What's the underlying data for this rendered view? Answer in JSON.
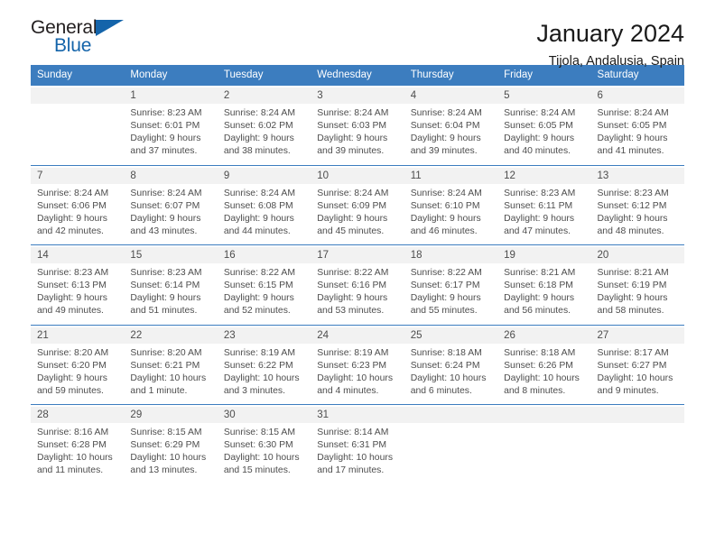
{
  "logo": {
    "word_one": "General",
    "word_two": "Blue",
    "triangle": "triangle-mark",
    "brand_color": "#1464aa",
    "text_color": "#231f20"
  },
  "header": {
    "title": "January 2024",
    "subtitle": "Tijola, Andalusia, Spain"
  },
  "calendar": {
    "header_bg": "#3c7dbf",
    "daynum_bg": "#f2f2f2",
    "weekdays": [
      "Sunday",
      "Monday",
      "Tuesday",
      "Wednesday",
      "Thursday",
      "Friday",
      "Saturday"
    ],
    "weeks": [
      {
        "days": [
          {
            "num": "",
            "sunrise": "",
            "sunset": "",
            "daylight": ""
          },
          {
            "num": "1",
            "sunrise": "Sunrise: 8:23 AM",
            "sunset": "Sunset: 6:01 PM",
            "daylight": "Daylight: 9 hours and 37 minutes."
          },
          {
            "num": "2",
            "sunrise": "Sunrise: 8:24 AM",
            "sunset": "Sunset: 6:02 PM",
            "daylight": "Daylight: 9 hours and 38 minutes."
          },
          {
            "num": "3",
            "sunrise": "Sunrise: 8:24 AM",
            "sunset": "Sunset: 6:03 PM",
            "daylight": "Daylight: 9 hours and 39 minutes."
          },
          {
            "num": "4",
            "sunrise": "Sunrise: 8:24 AM",
            "sunset": "Sunset: 6:04 PM",
            "daylight": "Daylight: 9 hours and 39 minutes."
          },
          {
            "num": "5",
            "sunrise": "Sunrise: 8:24 AM",
            "sunset": "Sunset: 6:05 PM",
            "daylight": "Daylight: 9 hours and 40 minutes."
          },
          {
            "num": "6",
            "sunrise": "Sunrise: 8:24 AM",
            "sunset": "Sunset: 6:05 PM",
            "daylight": "Daylight: 9 hours and 41 minutes."
          }
        ]
      },
      {
        "days": [
          {
            "num": "7",
            "sunrise": "Sunrise: 8:24 AM",
            "sunset": "Sunset: 6:06 PM",
            "daylight": "Daylight: 9 hours and 42 minutes."
          },
          {
            "num": "8",
            "sunrise": "Sunrise: 8:24 AM",
            "sunset": "Sunset: 6:07 PM",
            "daylight": "Daylight: 9 hours and 43 minutes."
          },
          {
            "num": "9",
            "sunrise": "Sunrise: 8:24 AM",
            "sunset": "Sunset: 6:08 PM",
            "daylight": "Daylight: 9 hours and 44 minutes."
          },
          {
            "num": "10",
            "sunrise": "Sunrise: 8:24 AM",
            "sunset": "Sunset: 6:09 PM",
            "daylight": "Daylight: 9 hours and 45 minutes."
          },
          {
            "num": "11",
            "sunrise": "Sunrise: 8:24 AM",
            "sunset": "Sunset: 6:10 PM",
            "daylight": "Daylight: 9 hours and 46 minutes."
          },
          {
            "num": "12",
            "sunrise": "Sunrise: 8:23 AM",
            "sunset": "Sunset: 6:11 PM",
            "daylight": "Daylight: 9 hours and 47 minutes."
          },
          {
            "num": "13",
            "sunrise": "Sunrise: 8:23 AM",
            "sunset": "Sunset: 6:12 PM",
            "daylight": "Daylight: 9 hours and 48 minutes."
          }
        ]
      },
      {
        "days": [
          {
            "num": "14",
            "sunrise": "Sunrise: 8:23 AM",
            "sunset": "Sunset: 6:13 PM",
            "daylight": "Daylight: 9 hours and 49 minutes."
          },
          {
            "num": "15",
            "sunrise": "Sunrise: 8:23 AM",
            "sunset": "Sunset: 6:14 PM",
            "daylight": "Daylight: 9 hours and 51 minutes."
          },
          {
            "num": "16",
            "sunrise": "Sunrise: 8:22 AM",
            "sunset": "Sunset: 6:15 PM",
            "daylight": "Daylight: 9 hours and 52 minutes."
          },
          {
            "num": "17",
            "sunrise": "Sunrise: 8:22 AM",
            "sunset": "Sunset: 6:16 PM",
            "daylight": "Daylight: 9 hours and 53 minutes."
          },
          {
            "num": "18",
            "sunrise": "Sunrise: 8:22 AM",
            "sunset": "Sunset: 6:17 PM",
            "daylight": "Daylight: 9 hours and 55 minutes."
          },
          {
            "num": "19",
            "sunrise": "Sunrise: 8:21 AM",
            "sunset": "Sunset: 6:18 PM",
            "daylight": "Daylight: 9 hours and 56 minutes."
          },
          {
            "num": "20",
            "sunrise": "Sunrise: 8:21 AM",
            "sunset": "Sunset: 6:19 PM",
            "daylight": "Daylight: 9 hours and 58 minutes."
          }
        ]
      },
      {
        "days": [
          {
            "num": "21",
            "sunrise": "Sunrise: 8:20 AM",
            "sunset": "Sunset: 6:20 PM",
            "daylight": "Daylight: 9 hours and 59 minutes."
          },
          {
            "num": "22",
            "sunrise": "Sunrise: 8:20 AM",
            "sunset": "Sunset: 6:21 PM",
            "daylight": "Daylight: 10 hours and 1 minute."
          },
          {
            "num": "23",
            "sunrise": "Sunrise: 8:19 AM",
            "sunset": "Sunset: 6:22 PM",
            "daylight": "Daylight: 10 hours and 3 minutes."
          },
          {
            "num": "24",
            "sunrise": "Sunrise: 8:19 AM",
            "sunset": "Sunset: 6:23 PM",
            "daylight": "Daylight: 10 hours and 4 minutes."
          },
          {
            "num": "25",
            "sunrise": "Sunrise: 8:18 AM",
            "sunset": "Sunset: 6:24 PM",
            "daylight": "Daylight: 10 hours and 6 minutes."
          },
          {
            "num": "26",
            "sunrise": "Sunrise: 8:18 AM",
            "sunset": "Sunset: 6:26 PM",
            "daylight": "Daylight: 10 hours and 8 minutes."
          },
          {
            "num": "27",
            "sunrise": "Sunrise: 8:17 AM",
            "sunset": "Sunset: 6:27 PM",
            "daylight": "Daylight: 10 hours and 9 minutes."
          }
        ]
      },
      {
        "days": [
          {
            "num": "28",
            "sunrise": "Sunrise: 8:16 AM",
            "sunset": "Sunset: 6:28 PM",
            "daylight": "Daylight: 10 hours and 11 minutes."
          },
          {
            "num": "29",
            "sunrise": "Sunrise: 8:15 AM",
            "sunset": "Sunset: 6:29 PM",
            "daylight": "Daylight: 10 hours and 13 minutes."
          },
          {
            "num": "30",
            "sunrise": "Sunrise: 8:15 AM",
            "sunset": "Sunset: 6:30 PM",
            "daylight": "Daylight: 10 hours and 15 minutes."
          },
          {
            "num": "31",
            "sunrise": "Sunrise: 8:14 AM",
            "sunset": "Sunset: 6:31 PM",
            "daylight": "Daylight: 10 hours and 17 minutes."
          },
          {
            "num": "",
            "sunrise": "",
            "sunset": "",
            "daylight": ""
          },
          {
            "num": "",
            "sunrise": "",
            "sunset": "",
            "daylight": ""
          },
          {
            "num": "",
            "sunrise": "",
            "sunset": "",
            "daylight": ""
          }
        ]
      }
    ]
  }
}
